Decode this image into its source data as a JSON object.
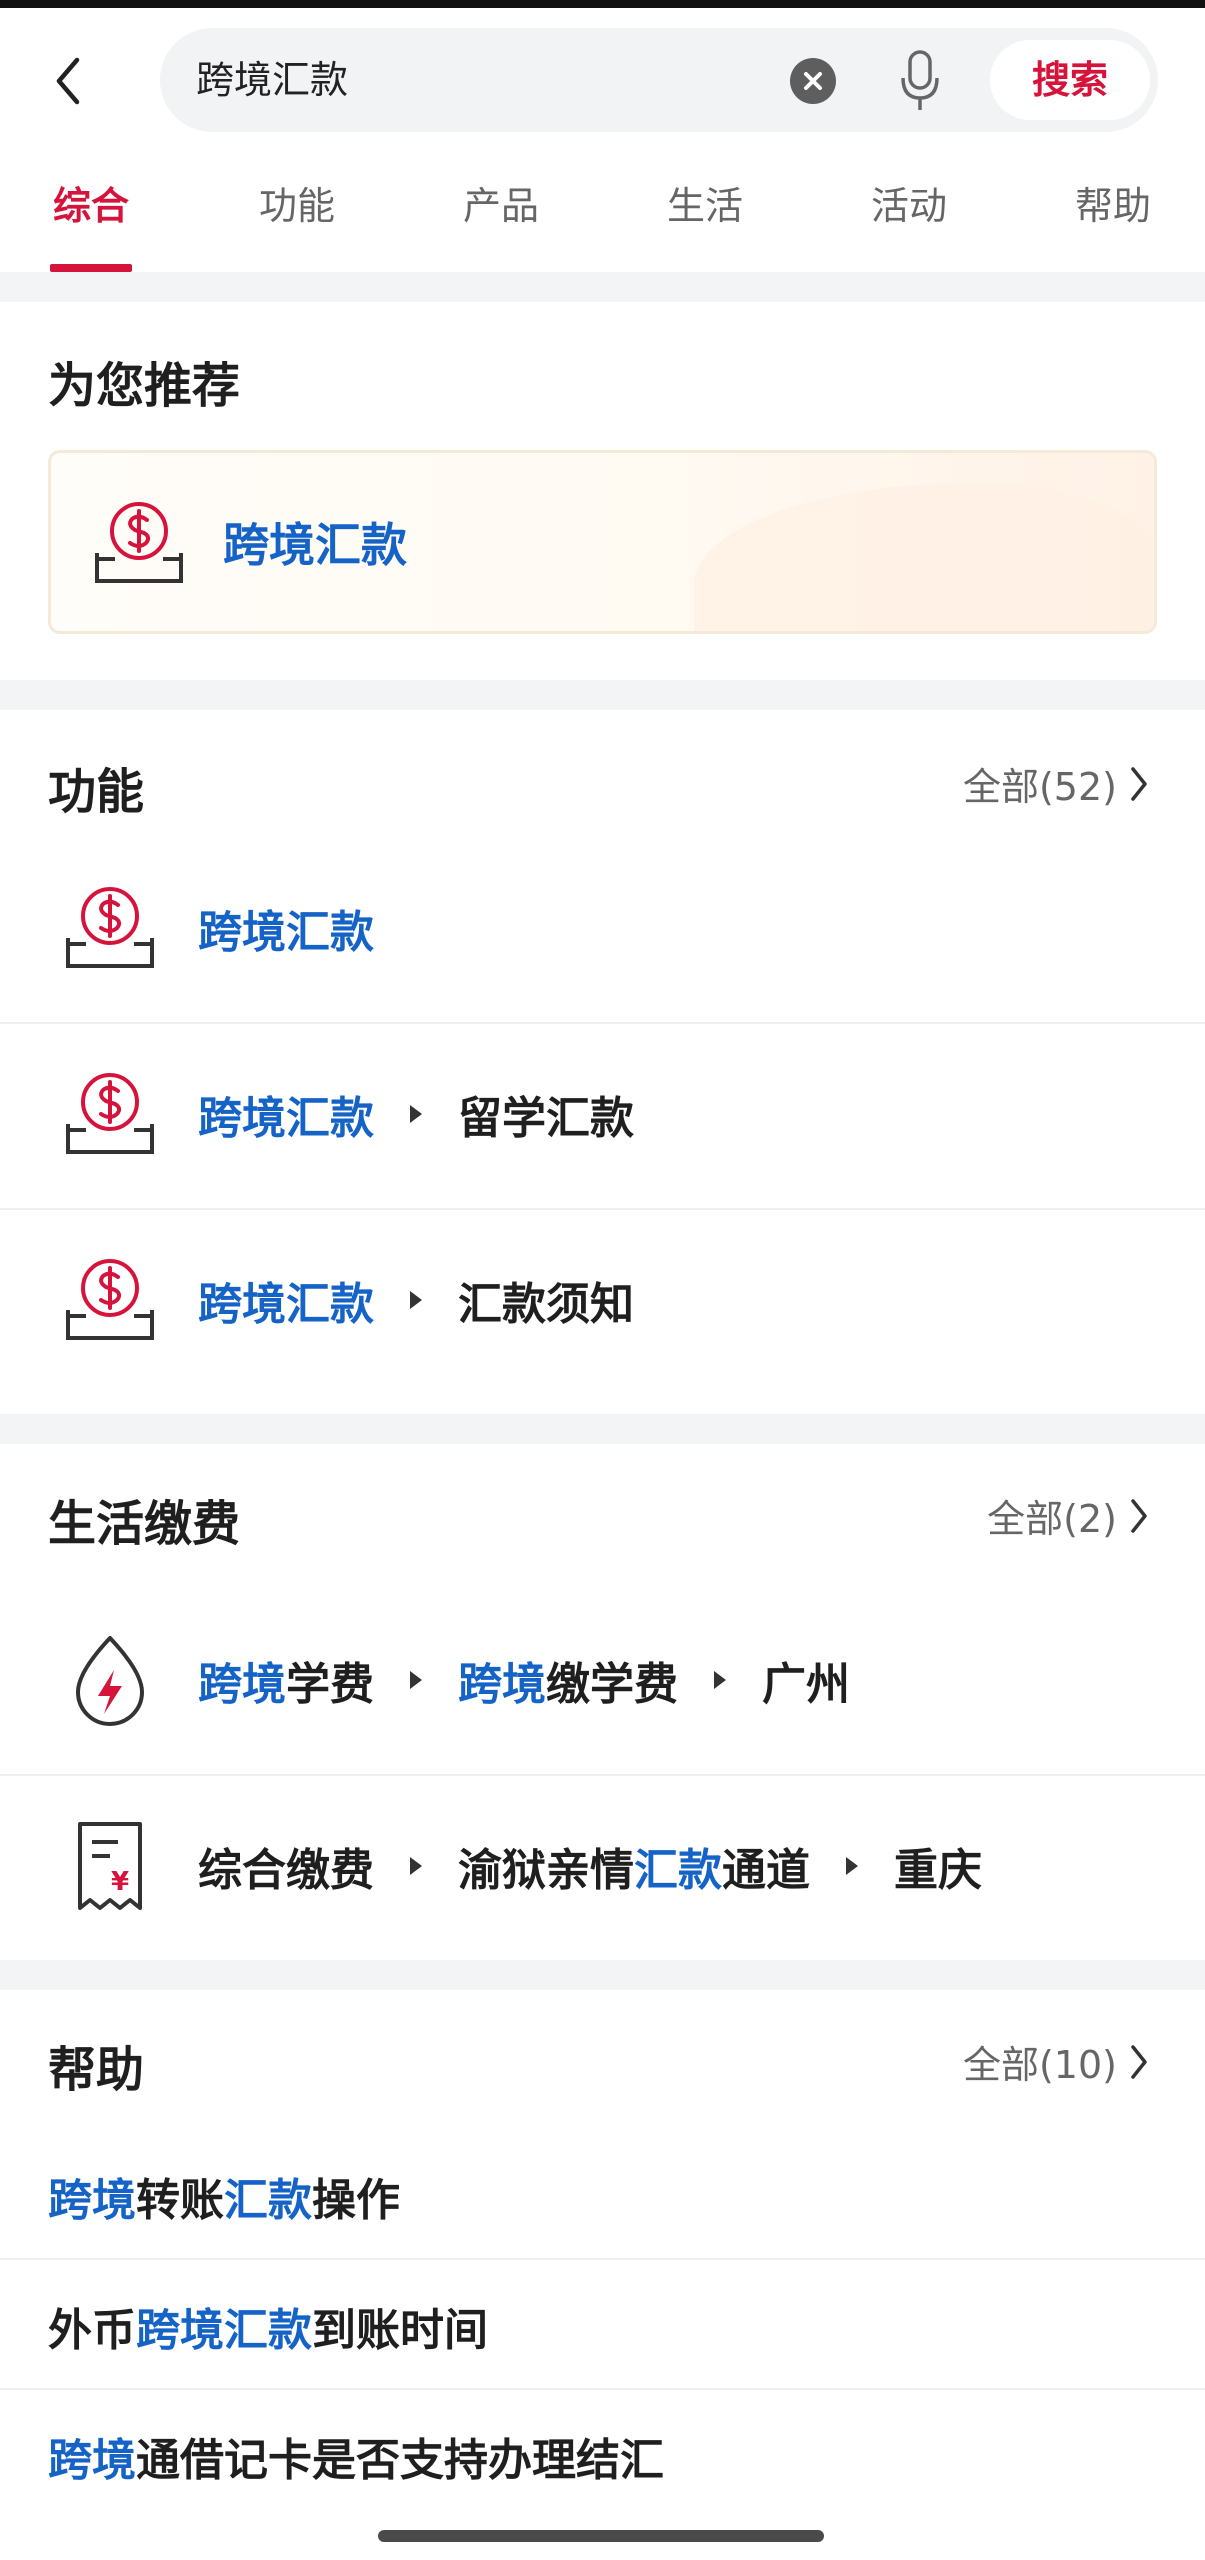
{
  "search": {
    "query": "跨境汇款",
    "button_label": "搜索"
  },
  "tabs": [
    {
      "label": "综合",
      "active": true
    },
    {
      "label": "功能",
      "active": false
    },
    {
      "label": "产品",
      "active": false
    },
    {
      "label": "生活",
      "active": false
    },
    {
      "label": "活动",
      "active": false
    },
    {
      "label": "帮助",
      "active": false
    }
  ],
  "recommend": {
    "title": "为您推荐",
    "item_label": "跨境汇款",
    "icon": "dollar-coin-tray-icon"
  },
  "functions": {
    "title": "功能",
    "more_label": "全部(52)",
    "items": [
      {
        "icon": "dollar-coin-tray-icon",
        "segments": [
          {
            "text": "跨境汇款",
            "hl": true
          }
        ]
      },
      {
        "icon": "dollar-coin-tray-icon",
        "segments": [
          {
            "text": "跨境汇款",
            "hl": true
          },
          {
            "text": "留学汇款",
            "hl": false
          }
        ]
      },
      {
        "icon": "dollar-coin-tray-icon",
        "segments": [
          {
            "text": "跨境汇款",
            "hl": true
          },
          {
            "text": "汇款须知",
            "hl": false
          }
        ]
      }
    ]
  },
  "life": {
    "title": "生活缴费",
    "more_label": "全部(2)",
    "items": [
      {
        "icon": "electricity-drop-icon",
        "segments": [
          [
            {
              "text": "跨境",
              "hl": true
            },
            {
              "text": "学费",
              "hl": false
            }
          ],
          [
            {
              "text": "跨境",
              "hl": true
            },
            {
              "text": "缴学费",
              "hl": false
            }
          ],
          [
            {
              "text": "广州",
              "hl": false
            }
          ]
        ]
      },
      {
        "icon": "receipt-yen-icon",
        "segments": [
          [
            {
              "text": "综合缴费",
              "hl": false
            }
          ],
          [
            {
              "text": "渝狱亲情",
              "hl": false
            },
            {
              "text": "汇款",
              "hl": true
            },
            {
              "text": "通道",
              "hl": false
            }
          ],
          [
            {
              "text": "重庆",
              "hl": false
            }
          ]
        ]
      }
    ]
  },
  "help": {
    "title": "帮助",
    "more_label": "全部(10)",
    "items": [
      [
        {
          "text": "跨境",
          "hl": true
        },
        {
          "text": "转账",
          "hl": false
        },
        {
          "text": "汇款",
          "hl": true
        },
        {
          "text": "操作",
          "hl": false
        }
      ],
      [
        {
          "text": "外币",
          "hl": false
        },
        {
          "text": "跨境汇款",
          "hl": true
        },
        {
          "text": "到账时间",
          "hl": false
        }
      ],
      [
        {
          "text": "跨境",
          "hl": true
        },
        {
          "text": "通借记卡是否支持办理结汇",
          "hl": false
        }
      ]
    ]
  },
  "colors": {
    "accent_red": "#d5133b",
    "highlight_blue": "#1663c7"
  }
}
